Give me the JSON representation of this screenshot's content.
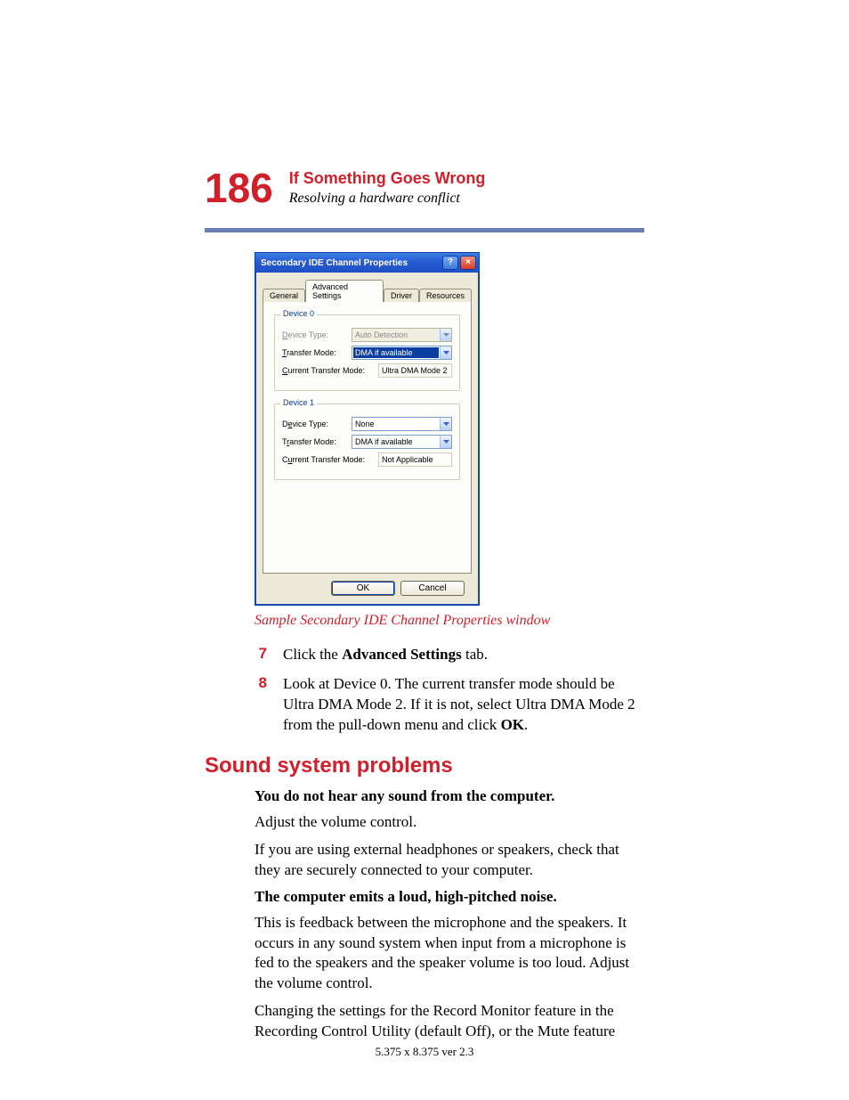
{
  "page_number": "186",
  "header": {
    "title": "If Something Goes Wrong",
    "subtitle": "Resolving a hardware conflict"
  },
  "dialog": {
    "title": "Secondary IDE Channel Properties",
    "tabs": [
      "General",
      "Advanced Settings",
      "Driver",
      "Resources"
    ],
    "active_tab_index": 1,
    "device0": {
      "legend": "Device 0",
      "device_type_label": "Device Type:",
      "device_type_value": "Auto Detection",
      "transfer_mode_label": "Transfer Mode:",
      "transfer_mode_value": "DMA if available",
      "current_label": "Current Transfer Mode:",
      "current_value": "Ultra DMA Mode 2"
    },
    "device1": {
      "legend": "Device 1",
      "device_type_label": "Device Type:",
      "device_type_value": "None",
      "transfer_mode_label": "Transfer Mode:",
      "transfer_mode_value": "DMA if available",
      "current_label": "Current Transfer Mode:",
      "current_value": "Not Applicable"
    },
    "ok": "OK",
    "cancel": "Cancel"
  },
  "caption": "Sample Secondary IDE Channel Properties window",
  "steps": {
    "s7_num": "7",
    "s7_a": "Click the ",
    "s7_b": "Advanced Settings",
    "s7_c": " tab.",
    "s8_num": "8",
    "s8_a": "Look at Device 0. The current transfer mode should be Ultra DMA Mode 2. If it is not, select Ultra DMA Mode 2 from the pull-down menu and click ",
    "s8_b": "OK",
    "s8_c": "."
  },
  "h2": "Sound system problems",
  "sec1": {
    "h3": "You do not hear any sound from the computer.",
    "p1": "Adjust the volume control.",
    "p2": "If you are using external headphones or speakers, check that they are securely connected to your computer."
  },
  "sec2": {
    "h3": "The computer emits a loud, high-pitched noise.",
    "p1": "This is feedback between the microphone and the speakers. It occurs in any sound system when input from a microphone is fed to the speakers and the speaker volume is too loud. Adjust the volume control.",
    "p2": "Changing the settings for the Record Monitor feature in the Recording Control Utility (default Off), or the Mute feature"
  },
  "footer": "5.375 x 8.375 ver 2.3"
}
